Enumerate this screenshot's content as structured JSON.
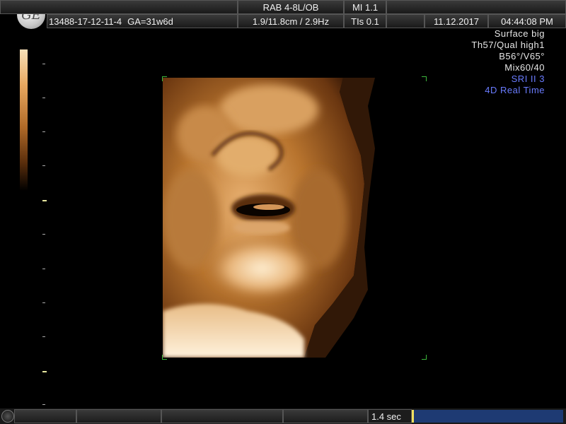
{
  "header": {
    "logo_text": "GE",
    "patient_id": "13488-17-12-11-4",
    "gest_age": "GA=31w6d",
    "probe": "RAB 4-8L/OB",
    "depth_freq": "1.9/11.8cm / 2.9Hz",
    "mi": "MI  1.1",
    "tis": "TIs  0.1",
    "date": "11.12.2017",
    "time": "04:44:08 PM"
  },
  "params": {
    "lines": [
      "Surface big",
      "Th57/Qual high1",
      "B56°/V65°",
      "Mix60/40"
    ],
    "blue_lines": [
      "SRI II 3",
      "4D Real Time"
    ]
  },
  "colors": {
    "accent_blue": "#6a7cff",
    "cine_bar": "#1e3a73",
    "roi_corner": "#3cb83c",
    "skin_tone": "#c98a4a"
  },
  "cine": {
    "duration": "1.4 sec",
    "position": 0.0
  },
  "scan": {
    "icon": "fetal-face-3d-render"
  }
}
